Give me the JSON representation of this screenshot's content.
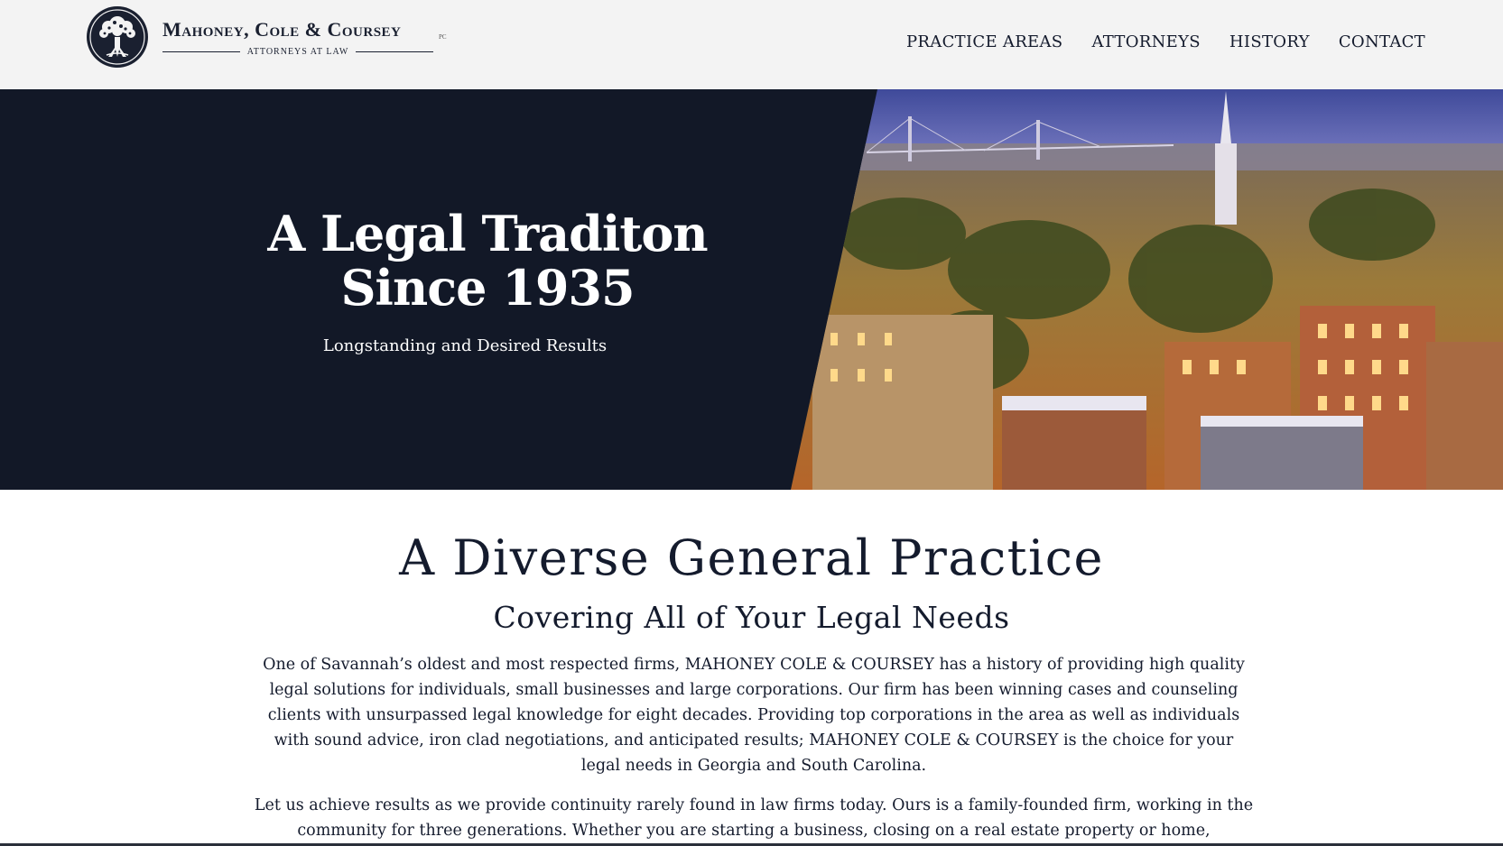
{
  "header": {
    "brand_name": "Mahoney, Cole & Coursey",
    "brand_suffix": "PC",
    "brand_tagline": "ATTORNEYS AT LAW",
    "logo_icon": "tree-emblem-icon"
  },
  "nav": {
    "items": [
      {
        "label": "PRACTICE AREAS"
      },
      {
        "label": "ATTORNEYS"
      },
      {
        "label": "HISTORY"
      },
      {
        "label": "CONTACT"
      }
    ]
  },
  "hero": {
    "title": "A Legal Traditon Since 1935",
    "subtitle": "Longstanding and Desired Results",
    "image": "savannah-city-night-photo"
  },
  "main": {
    "heading": "A Diverse General Practice",
    "subheading": "Covering All of Your Legal Needs",
    "paragraphs": [
      "One of Savannah’s oldest and most respected firms, MAHONEY COLE & COURSEY has a history of providing high quality legal solutions for individuals, small businesses and large corporations. Our firm has been winning cases and counseling clients with unsurpassed legal knowledge for eight decades. Providing top corporations in the area as well as individuals with sound advice, iron clad negotiations, and anticipated results; MAHONEY COLE & COURSEY is the choice for your legal needs in Georgia and South Carolina.",
      "Let us achieve results as we provide continuity rarely found in law firms today. Ours is a family-founded firm, working in the community for three generations. Whether you are starting a business, closing on a real estate property or home,"
    ]
  },
  "colors": {
    "navy": "#121827",
    "header_bg": "#f3f3f3",
    "text": "#141b2d"
  }
}
